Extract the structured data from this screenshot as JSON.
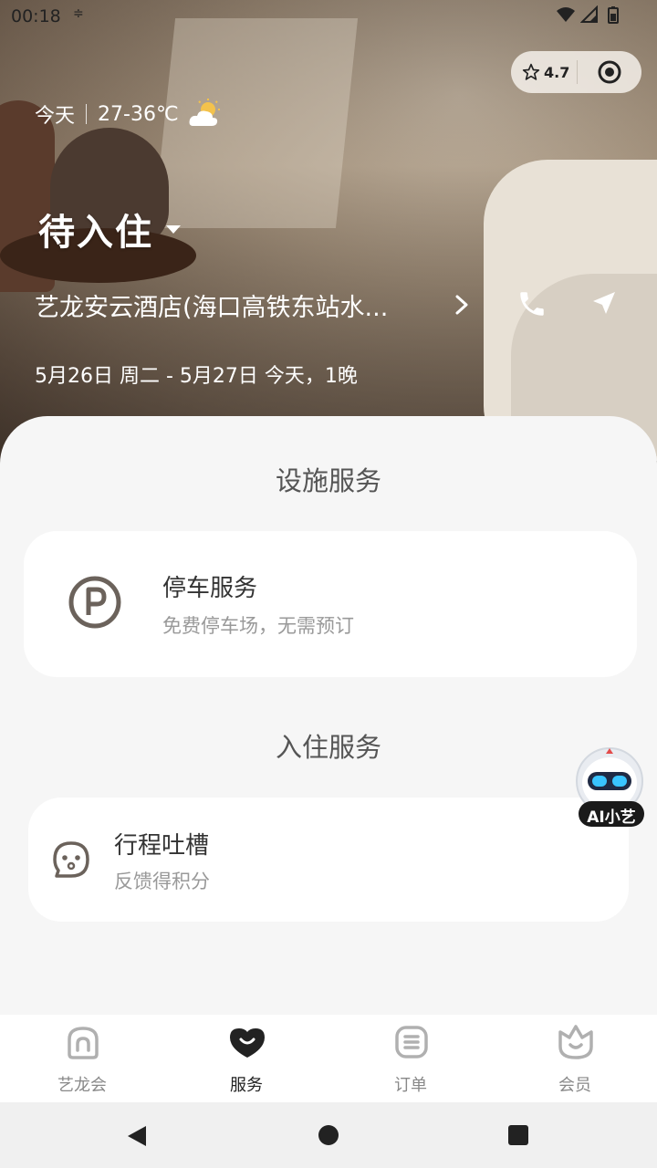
{
  "status_bar": {
    "time": "00:18",
    "extra": "≑"
  },
  "capsule": {
    "rating": "4.7"
  },
  "weather": {
    "day": "今天",
    "temp": "27-36℃"
  },
  "stay": {
    "status": "待入住",
    "hotel_name": "艺龙安云酒店(海口高铁东站水...",
    "dates": "5月26日 周二 - 5月27日 今天，1晚"
  },
  "facility_section": {
    "title": "设施服务",
    "items": [
      {
        "title": "停车服务",
        "subtitle": "免费停车场，无需预订",
        "icon": "parking-icon"
      }
    ]
  },
  "checkin_section": {
    "title": "入住服务",
    "items": [
      {
        "title": "行程吐槽",
        "subtitle": "反馈得积分",
        "icon": "feedback-face-icon"
      }
    ]
  },
  "ai_assistant": {
    "label": "AI小艺"
  },
  "tabbar": {
    "tabs": [
      {
        "label": "艺龙会",
        "icon": "home-icon"
      },
      {
        "label": "服务",
        "icon": "heart-smile-icon",
        "active": true
      },
      {
        "label": "订单",
        "icon": "order-icon"
      },
      {
        "label": "会员",
        "icon": "member-icon"
      }
    ]
  },
  "colors": {
    "accent_dark": "#222222",
    "sheet_bg": "#f6f6f6",
    "muted_text": "#999999"
  }
}
